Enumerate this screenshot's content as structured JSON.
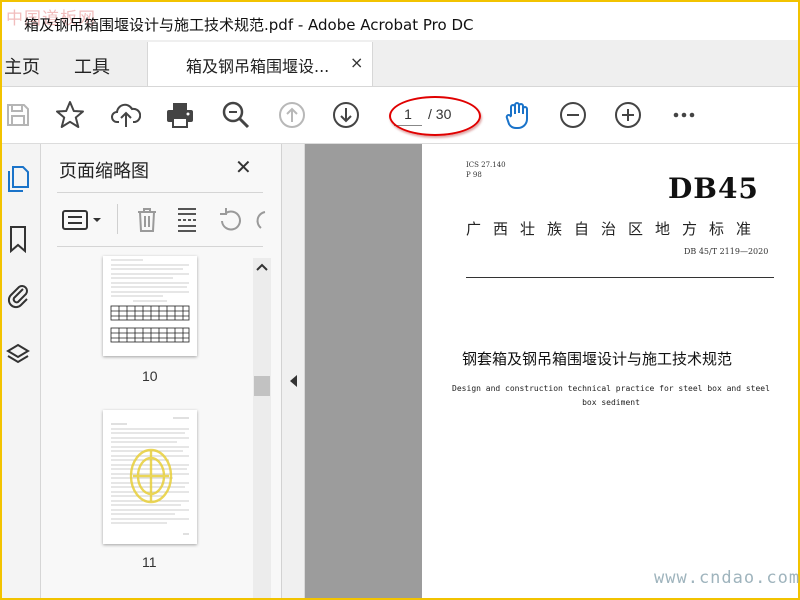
{
  "window": {
    "title": "箱及钢吊箱围堰设计与施工技术规范.pdf - Adobe Acrobat Pro DC",
    "watermark_top": "中国道板网",
    "watermark_bottom": "www.cndao.com"
  },
  "tabs": {
    "home": "主页",
    "tools": "工具",
    "document": "箱及钢吊箱围堰设...",
    "close": "×"
  },
  "toolbar": {
    "current_page": "1",
    "total_pages": "/ 30",
    "accent": "#1a73c9",
    "highlight": "#e00000"
  },
  "panel": {
    "title": "页面缩略图",
    "close": "✕",
    "thumbnails": [
      {
        "label": "10"
      },
      {
        "label": "11"
      }
    ]
  },
  "document": {
    "ics_line1": "ICS 27.140",
    "ics_line2": "P 98",
    "code": "DB45",
    "region_title": "广西壮族自治区地方标准",
    "standard_number": "DB 45/T 2119—2020",
    "title_zh": "钢套箱及钢吊箱围堰设计与施工技术规范",
    "title_en": "Design and construction technical practice for steel box and steel box sediment"
  }
}
